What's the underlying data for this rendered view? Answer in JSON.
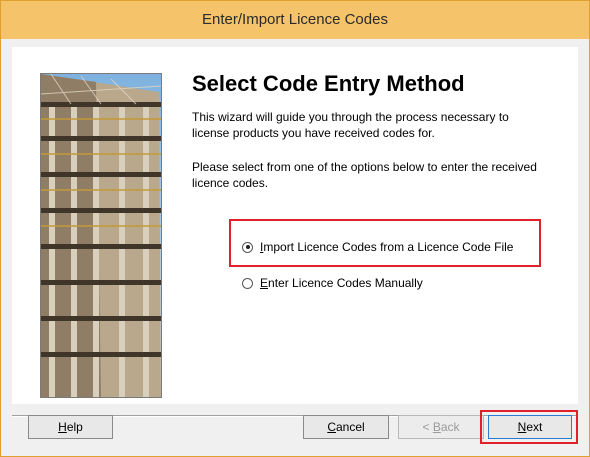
{
  "window": {
    "title": "Enter/Import Licence Codes"
  },
  "page": {
    "heading": "Select Code Entry Method",
    "intro": "This wizard will guide you through the process necessary to license products you have received codes for.",
    "instruction": "Please select from one of the options below to enter the received licence codes."
  },
  "options": [
    {
      "label_mnemonic": "I",
      "label_rest": "mport Licence Codes from a Licence Code File",
      "selected": true
    },
    {
      "label_mnemonic": "E",
      "label_rest": "nter Licence Codes Manually",
      "selected": false
    }
  ],
  "buttons": {
    "help": {
      "mnemonic": "H",
      "rest": "elp"
    },
    "cancel": {
      "mnemonic": "C",
      "rest": "ancel"
    },
    "back": {
      "prefix": "< ",
      "mnemonic": "B",
      "rest": "ack",
      "enabled": false
    },
    "next": {
      "mnemonic": "N",
      "rest": "ext"
    }
  },
  "colors": {
    "title_bar": "#f4c36a",
    "highlight": "#e0202a",
    "default_button_border": "#2a7bd6"
  }
}
